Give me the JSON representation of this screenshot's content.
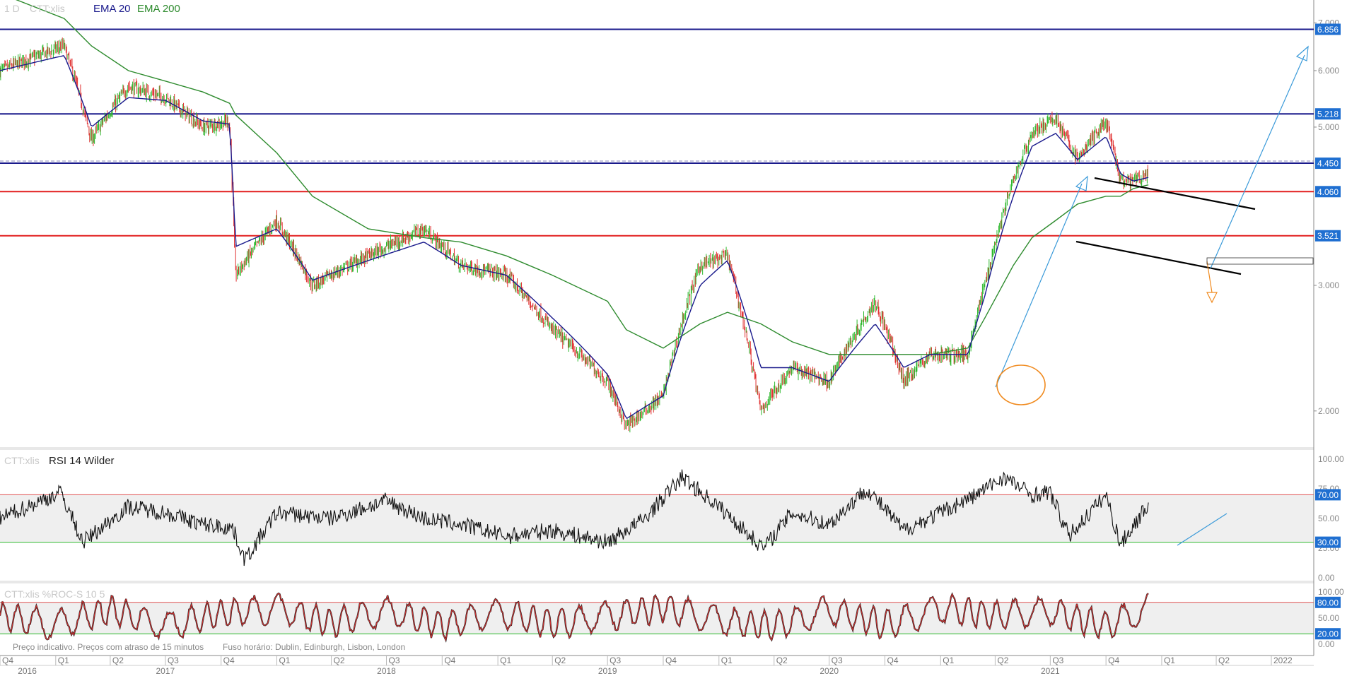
{
  "header": {
    "interval": "1 D",
    "symbol": "CTT:xlis",
    "ind1": "EMA 20",
    "ind2": "EMA 200"
  },
  "colors": {
    "ema20": "#1a1a8c",
    "ema200": "#2e8b2e",
    "resistance": "#1a1a8c",
    "support": "#e21f1f",
    "up_candle": "#2db82d",
    "down_candle": "#e03030",
    "trend_arrow": "#3a9ad9",
    "down_arrow": "#f08a1e",
    "circle": "#f08a1e",
    "rsi_upper": "#e05050",
    "rsi_lower": "#2db82d",
    "tag_bg": "#1f6fd1"
  },
  "price_axis": {
    "ticks": [
      "7.000",
      "6.000",
      "5.000",
      "3.000",
      "2.000"
    ],
    "tick_values": [
      7,
      6,
      5,
      3,
      2
    ],
    "levels": [
      {
        "label": "6.856",
        "value": 6.856,
        "kind": "resistance"
      },
      {
        "label": "5.218",
        "value": 5.218,
        "kind": "resistance"
      },
      {
        "label": "4.450",
        "value": 4.45,
        "kind": "resistance"
      },
      {
        "label": "4.060",
        "value": 4.06,
        "kind": "support"
      },
      {
        "label": "3.521",
        "value": 3.521,
        "kind": "support"
      }
    ]
  },
  "rsi": {
    "title_symbol": "CTT:xlis",
    "title": "RSI 14 Wilder",
    "ticks": [
      "100.00",
      "75.00",
      "50.00",
      "25.00",
      "0.00"
    ],
    "tick_values": [
      100,
      75,
      50,
      25,
      0
    ],
    "upper_label": "70.00",
    "lower_label": "30.00"
  },
  "stoch": {
    "title": "CTT:xlis  %ROC-S 10  5",
    "ticks": [
      "100.00",
      "50.00",
      "0.00"
    ],
    "tick_values": [
      100,
      50,
      0
    ],
    "upper_label": "80.00",
    "lower_label": "20.00"
  },
  "footer": {
    "notice": "Preço indicativo. Preços com atraso de 15 minutos",
    "timezone": "Fuso horário: Dublin, Edinburgh, Lisbon, London"
  },
  "time_axis": {
    "quarters": [
      "Q4",
      "Q1",
      "Q2",
      "Q3",
      "Q4",
      "Q1",
      "Q2",
      "Q3",
      "Q4",
      "Q1",
      "Q2",
      "Q3",
      "Q4",
      "Q1",
      "Q2",
      "Q3",
      "Q4",
      "Q1",
      "Q2",
      "Q3",
      "Q4",
      "Q1",
      "Q2",
      "2022"
    ],
    "quarter_dates": [
      "2016-10-01",
      "2017-01-01",
      "2017-04-01",
      "2017-07-01",
      "2017-10-01",
      "2018-01-01",
      "2018-04-01",
      "2018-07-01",
      "2018-10-01",
      "2019-01-01",
      "2019-04-01",
      "2019-07-01",
      "2019-10-01",
      "2020-01-01",
      "2020-04-01",
      "2020-07-01",
      "2020-10-01",
      "2021-01-01",
      "2021-04-01",
      "2021-07-01",
      "2021-10-01",
      "2022-01-01",
      "2022-04-01",
      "2022-07-01"
    ],
    "years": [
      "2016",
      "2017",
      "2018",
      "2019",
      "2020",
      "2021"
    ],
    "year_dates": [
      "2016-11-15",
      "2017-07-01",
      "2018-07-01",
      "2019-07-01",
      "2020-07-01",
      "2021-07-01"
    ]
  },
  "chart_data": [
    {
      "type": "line",
      "name": "price",
      "x": [
        "2016-10-01",
        "2017-01-15",
        "2017-03-01",
        "2017-05-01",
        "2017-07-01",
        "2017-09-01",
        "2017-10-15",
        "2017-10-25",
        "2018-01-01",
        "2018-03-01",
        "2018-06-01",
        "2018-09-01",
        "2018-11-01",
        "2019-01-15",
        "2019-04-01",
        "2019-07-01",
        "2019-08-01",
        "2019-10-01",
        "2019-12-01",
        "2020-01-15",
        "2020-03-10",
        "2020-05-01",
        "2020-07-01",
        "2020-09-15",
        "2020-11-01",
        "2020-12-15",
        "2021-02-15",
        "2021-03-15",
        "2021-05-01",
        "2021-06-01",
        "2021-07-10",
        "2021-08-15",
        "2021-10-01",
        "2021-10-25",
        "2021-11-15",
        "2021-12-10"
      ],
      "close": [
        6.0,
        6.5,
        4.8,
        5.7,
        5.5,
        5.0,
        5.1,
        3.1,
        3.7,
        3.0,
        3.3,
        3.6,
        3.2,
        3.1,
        2.6,
        2.2,
        1.9,
        2.1,
        3.2,
        3.3,
        2.0,
        2.3,
        2.2,
        2.85,
        2.2,
        2.4,
        2.4,
        3.0,
        4.2,
        4.9,
        5.15,
        4.5,
        5.1,
        4.2,
        4.2,
        4.3
      ],
      "ema20": [
        6.0,
        6.3,
        5.0,
        5.5,
        5.45,
        5.1,
        5.05,
        3.4,
        3.6,
        3.05,
        3.25,
        3.45,
        3.2,
        3.1,
        2.7,
        2.25,
        1.95,
        2.1,
        3.0,
        3.25,
        2.3,
        2.3,
        2.2,
        2.65,
        2.3,
        2.4,
        2.4,
        2.9,
        4.0,
        4.7,
        4.9,
        4.5,
        4.85,
        4.3,
        4.2,
        4.25
      ],
      "ema200": [
        7.7,
        7.1,
        6.5,
        6.0,
        5.8,
        5.6,
        5.4,
        5.2,
        4.6,
        4.0,
        3.6,
        3.5,
        3.45,
        3.3,
        3.1,
        2.85,
        2.6,
        2.45,
        2.65,
        2.75,
        2.65,
        2.5,
        2.4,
        2.4,
        2.4,
        2.4,
        2.45,
        2.7,
        3.2,
        3.5,
        3.7,
        3.9,
        4.0,
        4.0,
        4.1,
        4.15
      ],
      "ylim": [
        1.8,
        7.4
      ]
    },
    {
      "type": "line",
      "name": "rsi",
      "x": [
        "2016-10-01",
        "2017-01-10",
        "2017-02-15",
        "2017-05-01",
        "2017-07-01",
        "2017-09-01",
        "2017-10-20",
        "2017-11-10",
        "2018-01-01",
        "2018-04-01",
        "2018-07-01",
        "2018-09-01",
        "2018-11-01",
        "2019-01-15",
        "2019-04-01",
        "2019-07-01",
        "2019-09-01",
        "2019-11-01",
        "2020-01-01",
        "2020-03-15",
        "2020-05-01",
        "2020-07-01",
        "2020-09-01",
        "2020-11-01",
        "2021-01-01",
        "2021-03-01",
        "2021-04-15",
        "2021-06-01",
        "2021-07-01",
        "2021-08-01",
        "2021-10-01",
        "2021-10-25",
        "2021-12-10"
      ],
      "values": [
        50,
        72,
        30,
        60,
        55,
        45,
        42,
        15,
        55,
        50,
        65,
        50,
        45,
        35,
        40,
        30,
        50,
        85,
        60,
        25,
        55,
        45,
        75,
        40,
        55,
        70,
        85,
        70,
        72,
        35,
        70,
        28,
        62
      ],
      "ylim": [
        0,
        100
      ]
    },
    {
      "type": "line",
      "name": "stoch",
      "x": [
        "2016-10-01",
        "2017-01-01",
        "2017-04-01",
        "2017-07-01",
        "2017-10-01",
        "2018-01-01",
        "2018-04-01",
        "2018-07-01",
        "2018-10-01",
        "2019-01-01",
        "2019-04-01",
        "2019-07-01",
        "2019-10-01",
        "2020-01-01",
        "2020-04-01",
        "2020-07-01",
        "2020-10-01",
        "2021-01-01",
        "2021-04-01",
        "2021-07-01",
        "2021-10-01",
        "2021-12-10"
      ],
      "values": [
        60,
        20,
        85,
        15,
        70,
        90,
        30,
        80,
        20,
        75,
        25,
        60,
        95,
        40,
        15,
        85,
        20,
        90,
        60,
        80,
        15,
        90
      ],
      "ylim": [
        0,
        100
      ]
    }
  ]
}
